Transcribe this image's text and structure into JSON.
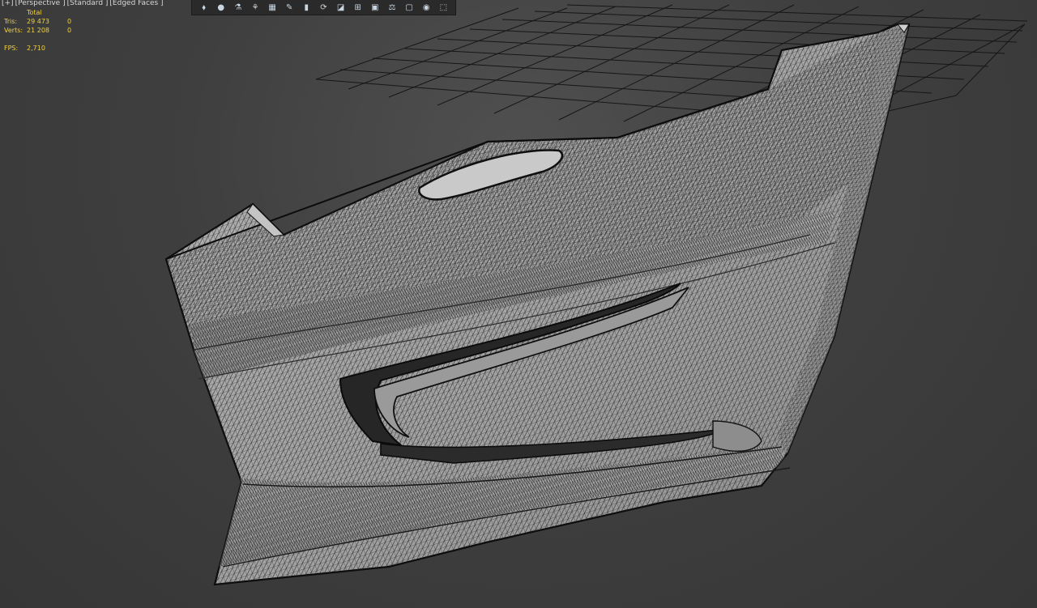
{
  "viewport": {
    "label_parts": [
      "[+]",
      "[Perspective ]",
      "[Standard ]",
      "[Edged Faces ]"
    ]
  },
  "stats": {
    "header": "Total",
    "tris_label": "Tris:",
    "tris_total": "29 473",
    "tris_selected": "0",
    "verts_label": "Verts:",
    "verts_total": "21 208",
    "verts_selected": "0",
    "fps_label": "FPS:",
    "fps_value": "2,710"
  },
  "toolbar": {
    "buttons": [
      {
        "name": "isolate-icon",
        "glyph": "⬧"
      },
      {
        "name": "dot-select-icon",
        "glyph": "●"
      },
      {
        "name": "bone-icon",
        "glyph": "⚗"
      },
      {
        "name": "figure-icon",
        "glyph": "⚘"
      },
      {
        "name": "grid-panel-icon",
        "glyph": "▦"
      },
      {
        "name": "pencil-icon",
        "glyph": "✎"
      },
      {
        "name": "page-icon",
        "glyph": "▮"
      },
      {
        "name": "cycle-icon",
        "glyph": "⟳"
      },
      {
        "name": "material-icon",
        "glyph": "◪"
      },
      {
        "name": "frame-icon",
        "glyph": "⊞"
      },
      {
        "name": "screen-icon",
        "glyph": "▣"
      },
      {
        "name": "scale-icon",
        "glyph": "⚖"
      },
      {
        "name": "monitor-icon",
        "glyph": "▢"
      },
      {
        "name": "eye-icon",
        "glyph": "◉"
      },
      {
        "name": "cube-icon",
        "glyph": "⬚"
      }
    ]
  },
  "colors": {
    "stats_text": "#f0d040",
    "mesh_fill": "#a9a9a9",
    "wire": "#1a1a1a",
    "grid": "#151515"
  }
}
